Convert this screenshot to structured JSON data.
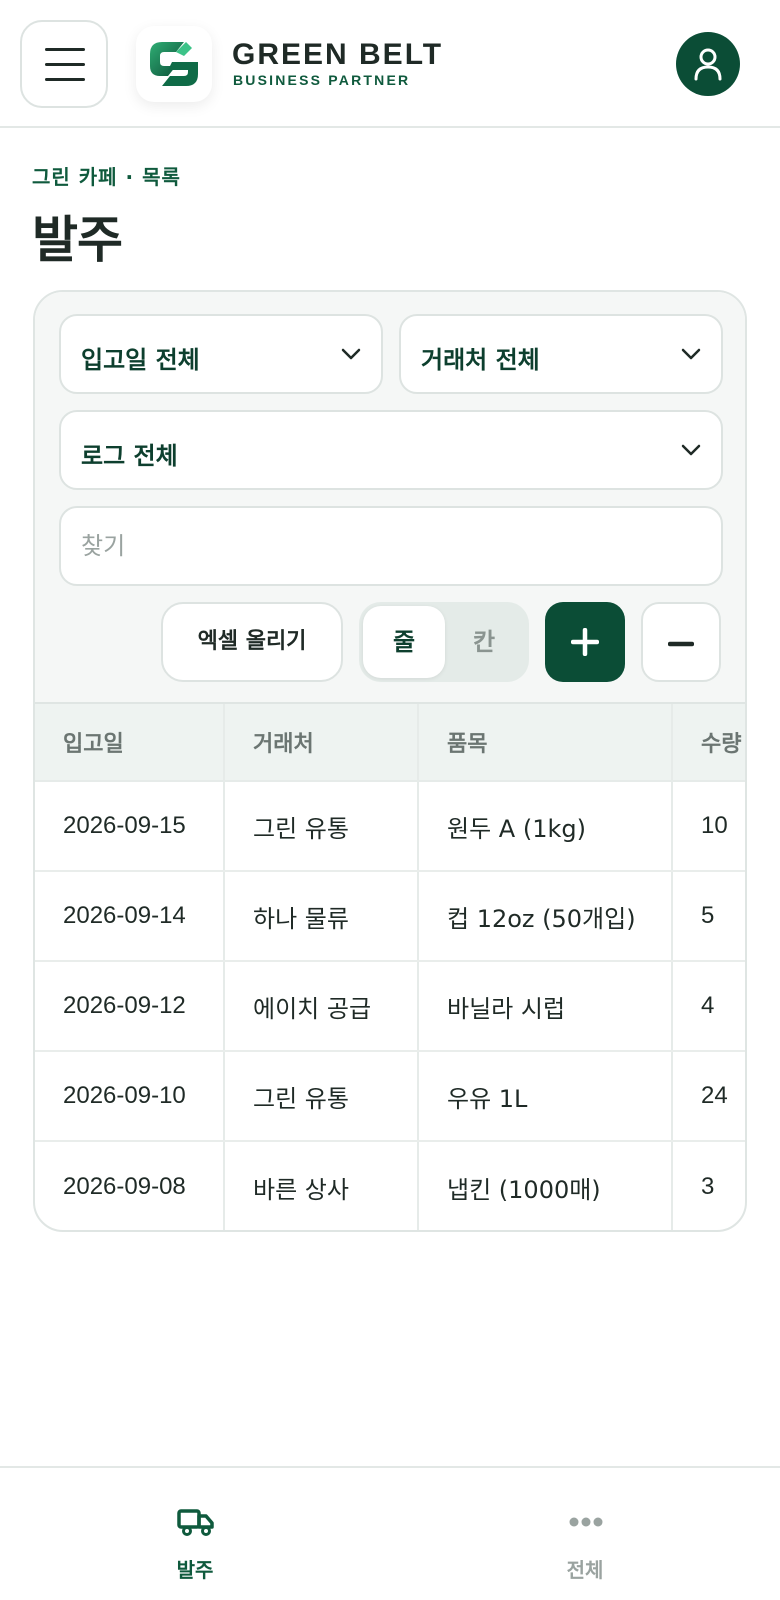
{
  "header": {
    "brand_name": "GREEN BELT",
    "brand_sub": "BUSINESS PARTNER",
    "icons": {
      "menu": "hamburger-icon",
      "logo": "green-g-logo",
      "profile": "user-icon"
    }
  },
  "page": {
    "breadcrumb": "그린 카페 · 목록",
    "title": "발주"
  },
  "filters": {
    "date_select": "입고일 전체",
    "vendor_select": "거래처 전체",
    "log_select": "로그 전체",
    "search_placeholder": "찾기",
    "excel_button": "엑셀 올리기",
    "view_toggle": {
      "row": "줄",
      "column": "칸",
      "selected": "줄"
    }
  },
  "table": {
    "columns": [
      "입고일",
      "거래처",
      "품목",
      "수량"
    ],
    "rows": [
      [
        "2026-09-15",
        "그린 유통",
        "원두 A (1kg)",
        "10"
      ],
      [
        "2026-09-14",
        "하나 물류",
        "컵 12oz (50개입)",
        "5"
      ],
      [
        "2026-09-12",
        "에이치 공급",
        "바닐라 시럽",
        "4"
      ],
      [
        "2026-09-10",
        "그린 유통",
        "우유 1L",
        "24"
      ],
      [
        "2026-09-08",
        "바른 상사",
        "냅킨 (1000매)",
        "3"
      ]
    ]
  },
  "bottom_nav": {
    "items": [
      {
        "label": "발주",
        "icon": "truck-icon",
        "active": true
      },
      {
        "label": "전체",
        "icon": "more-dots-icon",
        "active": false
      }
    ]
  },
  "colors": {
    "primary": "#0b4d36",
    "accent_text": "#0f5a3d",
    "border": "#dde3e1",
    "muted": "#9aa3a0"
  }
}
